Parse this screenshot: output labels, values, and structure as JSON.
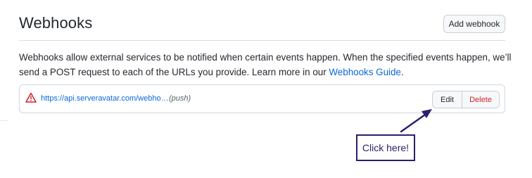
{
  "header": {
    "title": "Webhooks",
    "add_button_label": "Add webhook"
  },
  "description": {
    "text": "Webhooks allow external services to be notified when certain events happen. When the specified events happen, we’ll send a POST request to each of the URLs you provide. Learn more in our ",
    "link_text": "Webhooks Guide",
    "suffix": "."
  },
  "webhooks": [
    {
      "url": "https://api.serveravatar.com/webho…",
      "events": "(push)",
      "status_icon": "alert-icon",
      "edit_label": "Edit",
      "delete_label": "Delete"
    }
  ],
  "annotation": {
    "callout_text": "Click here!"
  },
  "colors": {
    "link": "#0969da",
    "danger": "#cf222e",
    "annotation": "#2c1f6b"
  }
}
